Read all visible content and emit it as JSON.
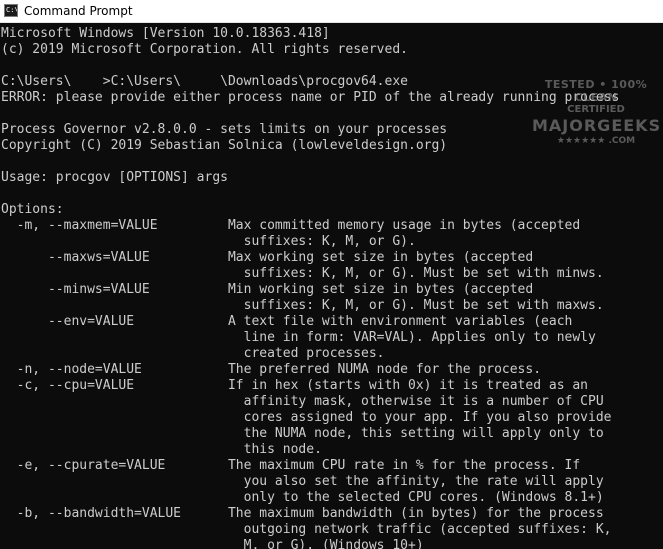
{
  "window": {
    "title": "Command Prompt",
    "icon": "cmd-icon",
    "icon_glyph": "C:\\"
  },
  "console": {
    "lines": [
      "Microsoft Windows [Version 10.0.18363.418]",
      "(c) 2019 Microsoft Corporation. All rights reserved.",
      "",
      "C:\\Users\\    >C:\\Users\\     \\Downloads\\procgov64.exe",
      "ERROR: please provide either process name or PID of the already running process",
      "",
      "Process Governor v2.8.0.0 - sets limits on your processes",
      "Copyright (C) 2019 Sebastian Solnica (lowleveldesign.org)",
      "",
      "Usage: procgov [OPTIONS] args",
      "",
      "Options:",
      "  -m, --maxmem=VALUE         Max committed memory usage in bytes (accepted",
      "                               suffixes: K, M, or G).",
      "      --maxws=VALUE          Max working set size in bytes (accepted",
      "                               suffixes: K, M, or G). Must be set with minws.",
      "      --minws=VALUE          Min working set size in bytes (accepted",
      "                               suffixes: K, M, or G). Must be set with maxws.",
      "      --env=VALUE            A text file with environment variables (each",
      "                               line in form: VAR=VAL). Applies only to newly",
      "                               created processes.",
      "  -n, --node=VALUE           The preferred NUMA node for the process.",
      "  -c, --cpu=VALUE            If in hex (starts with 0x) it is treated as an",
      "                               affinity mask, otherwise it is a number of CPU",
      "                               cores assigned to your app. If you also provide",
      "                               the NUMA node, this setting will apply only to",
      "                               this node.",
      "  -e, --cpurate=VALUE        The maximum CPU rate in % for the process. If",
      "                               you also set the affinity, the rate will apply",
      "                               only to the selected CPU cores. (Windows 8.1+)",
      "  -b, --bandwidth=VALUE      The maximum bandwidth (in bytes) for the process",
      "                               outgoing network traffic (accepted suffixes: K,",
      "                               M, or G). (Windows 10+)"
    ]
  },
  "watermark": {
    "top": "TESTED • 100% CLEAN",
    "mid": "CERTIFIED",
    "main": "MAJORGEEKS",
    "bot": "★★★★★★ .COM"
  }
}
